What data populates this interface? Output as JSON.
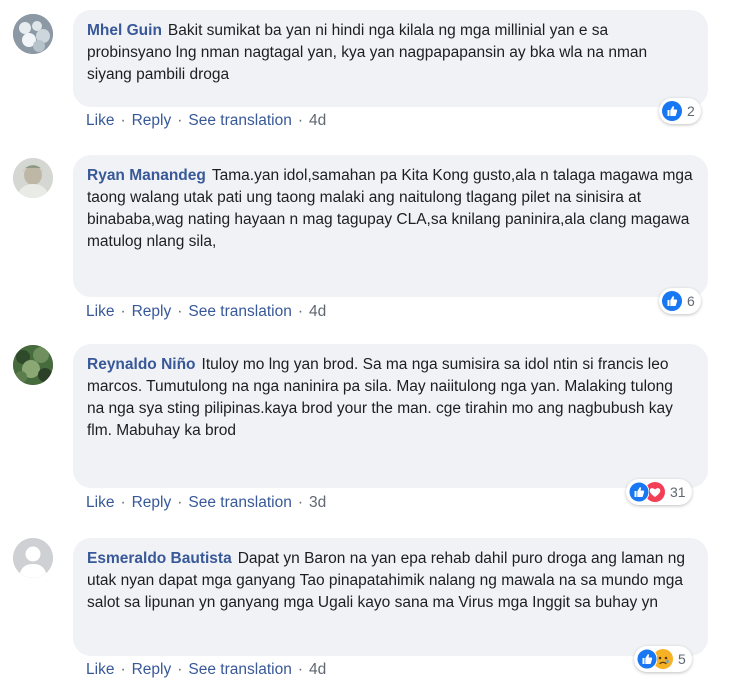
{
  "comments": [
    {
      "author": "Mhel Guin",
      "text": "Bakit sumikat ba yan ni hindi nga kilala ng mga millinial yan e sa probinsyano lng nman nagtagal yan, kya yan nagpapapansin ay bka wla na nman siyang pambili droga",
      "actions": {
        "like": "Like",
        "reply": "Reply",
        "translate": "See translation",
        "time": "4d"
      },
      "reactions": {
        "icons": [
          "like"
        ],
        "count": "2"
      }
    },
    {
      "author": "Ryan Manandeg",
      "text": "Tama.yan idol,samahan pa Kita Kong gusto,ala n talaga magawa mga taong walang utak pati ung taong malaki ang naitulong tlagang pilet na sinisira at binababa,wag nating hayaan n mag tagupay CLA,sa knilang paninira,ala clang magawa matulog nlang sila,",
      "actions": {
        "like": "Like",
        "reply": "Reply",
        "translate": "See translation",
        "time": "4d"
      },
      "reactions": {
        "icons": [
          "like"
        ],
        "count": "6"
      }
    },
    {
      "author": "Reynaldo Niño",
      "text": "Ituloy mo lng yan brod. Sa ma nga sumisira sa idol ntin si francis leo marcos. Tumutulong na nga naninira pa sila. May naiitulong nga yan. Malaking tulong na nga sya sting pilipinas.kaya brod your the man. cge tirahin mo ang nagbubush kay flm. Mabuhay ka brod",
      "actions": {
        "like": "Like",
        "reply": "Reply",
        "translate": "See translation",
        "time": "3d"
      },
      "reactions": {
        "icons": [
          "like",
          "love"
        ],
        "count": "31"
      }
    },
    {
      "author": "Esmeraldo Bautista",
      "text": "Dapat yn Baron na yan epa rehab dahil puro droga ang laman ng utak nyan dapat mga ganyang Tao pinapatahimik nalang ng mawala na sa mundo mga salot sa lipunan yn ganyang mga Ugali kayo sana ma Virus mga Inggit sa buhay yn",
      "actions": {
        "like": "Like",
        "reply": "Reply",
        "translate": "See translation",
        "time": "4d"
      },
      "reactions": {
        "icons": [
          "like",
          "sad"
        ],
        "count": "5"
      }
    }
  ],
  "colors": {
    "link": "#385898",
    "bubble": "#f0f2f5",
    "like": "#1877f2",
    "love": "#f33e58",
    "sad": "#f7b125"
  }
}
